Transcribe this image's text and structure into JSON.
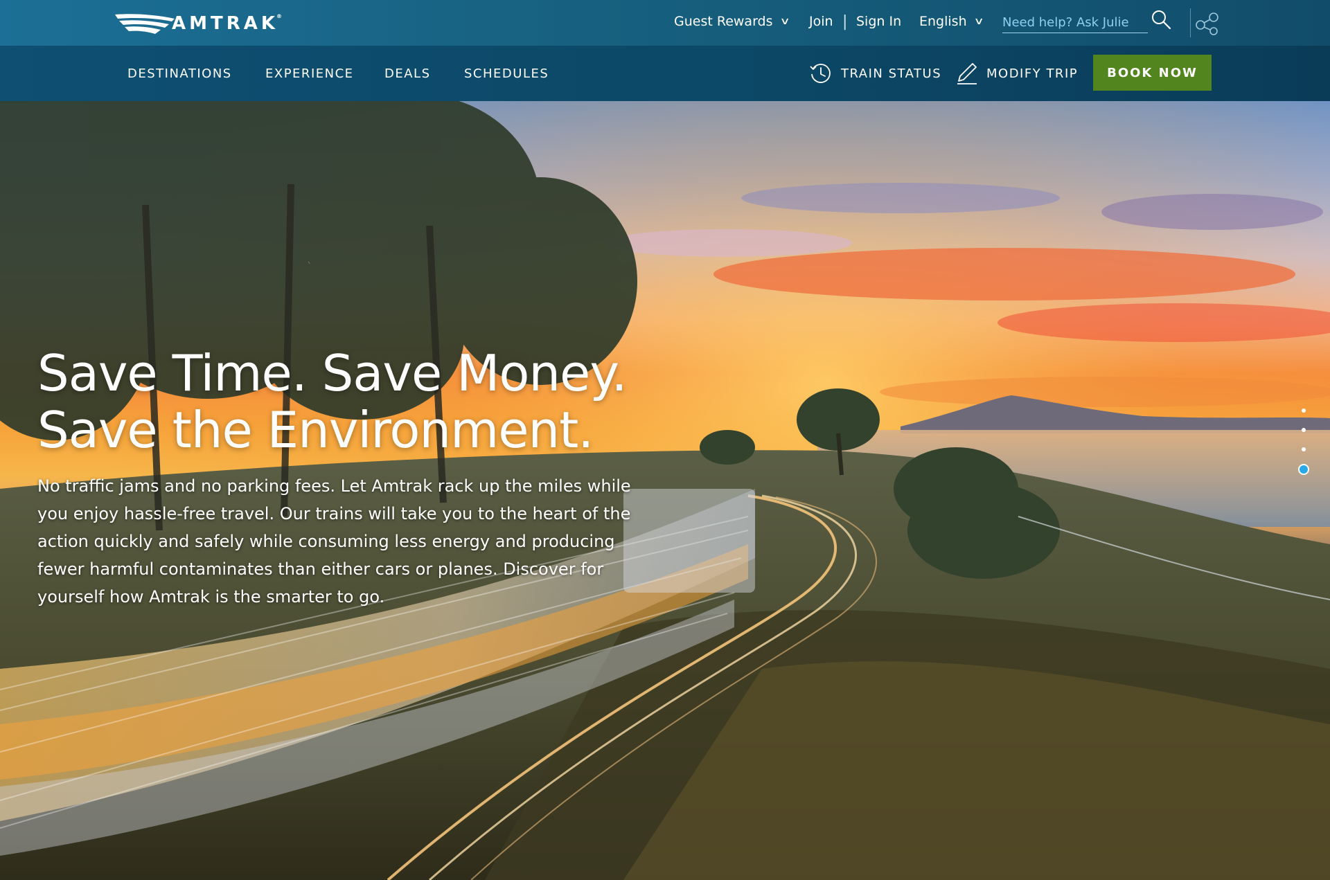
{
  "brand": {
    "name": "AMTRAK",
    "reg": "®"
  },
  "utility": {
    "guest_rewards": "Guest Rewards",
    "join": "Join",
    "separator": "|",
    "sign_in": "Sign In",
    "language": "English",
    "help_placeholder": "Need help? Ask Julie"
  },
  "nav": {
    "items": [
      "DESTINATIONS",
      "EXPERIENCE",
      "DEALS",
      "SCHEDULES"
    ],
    "train_status": "TRAIN STATUS",
    "modify_trip": "MODIFY TRIP",
    "book_now": "BOOK NOW"
  },
  "hero": {
    "headline_line1": "Save Time. Save Money.",
    "headline_line2": "Save the Environment.",
    "body": "No traffic jams and no parking fees. Let Amtrak rack up the miles while you enjoy hassle-free travel. Our trains will take you to the heart of the action quickly and safely while consuming less energy and producing fewer harmful contaminates than either cars or planes. Discover for yourself how Amtrak is the smarter to go.",
    "slides_total": 4,
    "active_slide": 4
  },
  "icons": {
    "search": "search-icon",
    "share": "share-icon",
    "clock": "clock-icon",
    "pencil": "pencil-icon",
    "chevron": "chevron-down-icon"
  },
  "colors": {
    "top_bar": "#1c6f96",
    "nav_bar": "#0e4f72",
    "book_button": "#53851f",
    "help_link": "#8fd0f2",
    "active_dot": "#2aa7e8"
  }
}
